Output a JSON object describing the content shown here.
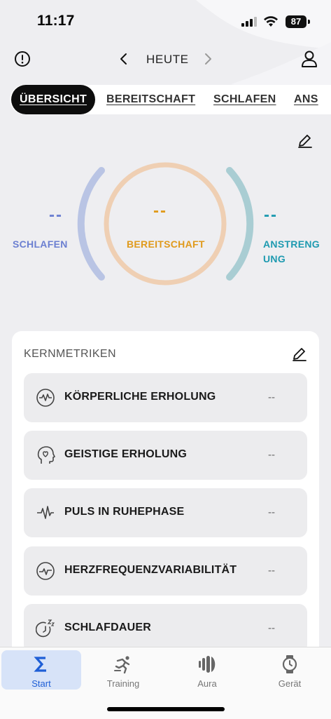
{
  "status_bar": {
    "time": "11:17",
    "battery": "87"
  },
  "header": {
    "date_label": "HEUTE"
  },
  "tabs": [
    {
      "label": "ÜBERSICHT",
      "active": true
    },
    {
      "label": "BEREITSCHAFT"
    },
    {
      "label": "SCHLAFEN"
    },
    {
      "label": "ANS"
    }
  ],
  "gauges": {
    "left": {
      "value": "--",
      "label": "SCHLAFEN",
      "color": "#6b7fd1"
    },
    "center": {
      "value": "--",
      "label": "BEREITSCHAFT",
      "color": "#e09a1c"
    },
    "right": {
      "value": "--",
      "label_line1": "ANSTRENG",
      "label_line2": "UNG",
      "color": "#1e9ab0"
    }
  },
  "kernmetriken": {
    "title": "KERNMETRIKEN",
    "items": [
      {
        "label": "KÖRPERLICHE ERHOLUNG",
        "value": "--",
        "icon": "pulse-circle-icon"
      },
      {
        "label": "GEISTIGE ERHOLUNG",
        "value": "--",
        "icon": "head-heart-icon"
      },
      {
        "label": "PULS IN RUHEPHASE",
        "value": "--",
        "icon": "heartbeat-wave-icon"
      },
      {
        "label": "HERZFREQUENZVARIABILITÄT",
        "value": "--",
        "icon": "hrv-circle-icon"
      },
      {
        "label": "SCHLAFDAUER",
        "value": "--",
        "icon": "sleep-clock-icon"
      }
    ]
  },
  "bottom_nav": [
    {
      "label": "Start",
      "active": true,
      "icon": "sigma-icon"
    },
    {
      "label": "Training",
      "icon": "runner-icon"
    },
    {
      "label": "Aura",
      "icon": "aura-icon"
    },
    {
      "label": "Gerät",
      "icon": "watch-icon"
    }
  ],
  "colors": {
    "accent": "#1f5fd6",
    "active_tab_bg": "#0d0d0d",
    "card_bg": "#ffffff",
    "metric_bg": "#ececee"
  }
}
